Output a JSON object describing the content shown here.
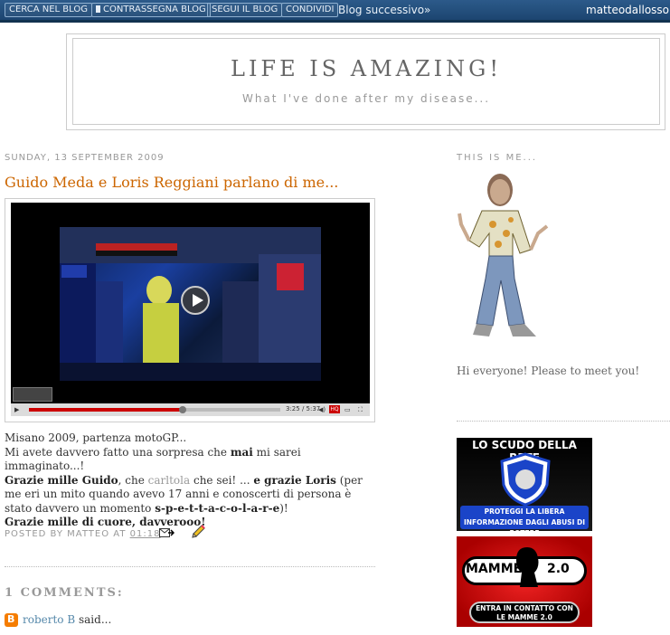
{
  "navbar": {
    "buttons": [
      "CERCA NEL BLOG",
      "CONTRASSEGNA BLOG",
      "SEGUI IL BLOG",
      "CONDIVIDI"
    ],
    "next_blog": "Blog successivo»",
    "username": "matteodallosso"
  },
  "header": {
    "title": "LIFE IS AMAZING!",
    "description": "What I've done after my disease..."
  },
  "post": {
    "date": "SUNDAY, 13 SEPTEMBER 2009",
    "title": "Guido Meda e Loris Reggiani parlano di me...",
    "video": {
      "time": "3:25 / 5:37",
      "progress": 0.61,
      "hq_label": "HQ"
    },
    "body": {
      "line1": "Misano 2009, partenza motoGP...",
      "line2_pre": "Mi avete davvero fatto una sorpresa che ",
      "line2_bold": "mai",
      "line2_post": " mi sarei immaginato...!",
      "line3_bold1": "Grazie mille Guido",
      "line3_mid": ", che ",
      "line3_link": "carltola",
      "line3_mid2": " che sei! ... ",
      "line3_bold2": "e grazie Loris",
      "line3_post": " (per me eri un mito quando avevo 17 anni e conoscerti di persona è stato davvero un momento ",
      "line3_bold3": "s-p-e-t-t-a-c-o-l-a-r-e",
      "line3_end": ")!",
      "line4": "Grazie mille di cuore, davverooo!"
    },
    "footer_prefix": "POSTED BY MATTEO AT",
    "footer_time": "01:18",
    "comments_title": "1 COMMENTS:",
    "comment_author": "roberto B",
    "comment_said": " said..."
  },
  "sidebar": {
    "title": "THIS IS ME...",
    "caption": "Hi everyone! Please to meet you!",
    "badge1": {
      "title": "LO SCUDO DELLA RETE",
      "text": "PROTEGGI LA LIBERA INFORMAZIONE DAGLI ABUSI DI POTERE"
    },
    "badge2": {
      "left": "MAMME",
      "right": "2.0",
      "cta": "ENTRA IN CONTATTO CON LE MAMME 2.0"
    }
  },
  "colors": {
    "navbar": "#2c5a8a",
    "post_title": "#cc6600",
    "progress": "#cc0000",
    "blogger": "#f57d00"
  },
  "icons": [
    "flag-icon",
    "play-icon",
    "email-icon",
    "pencil-icon",
    "blogger-icon"
  ]
}
